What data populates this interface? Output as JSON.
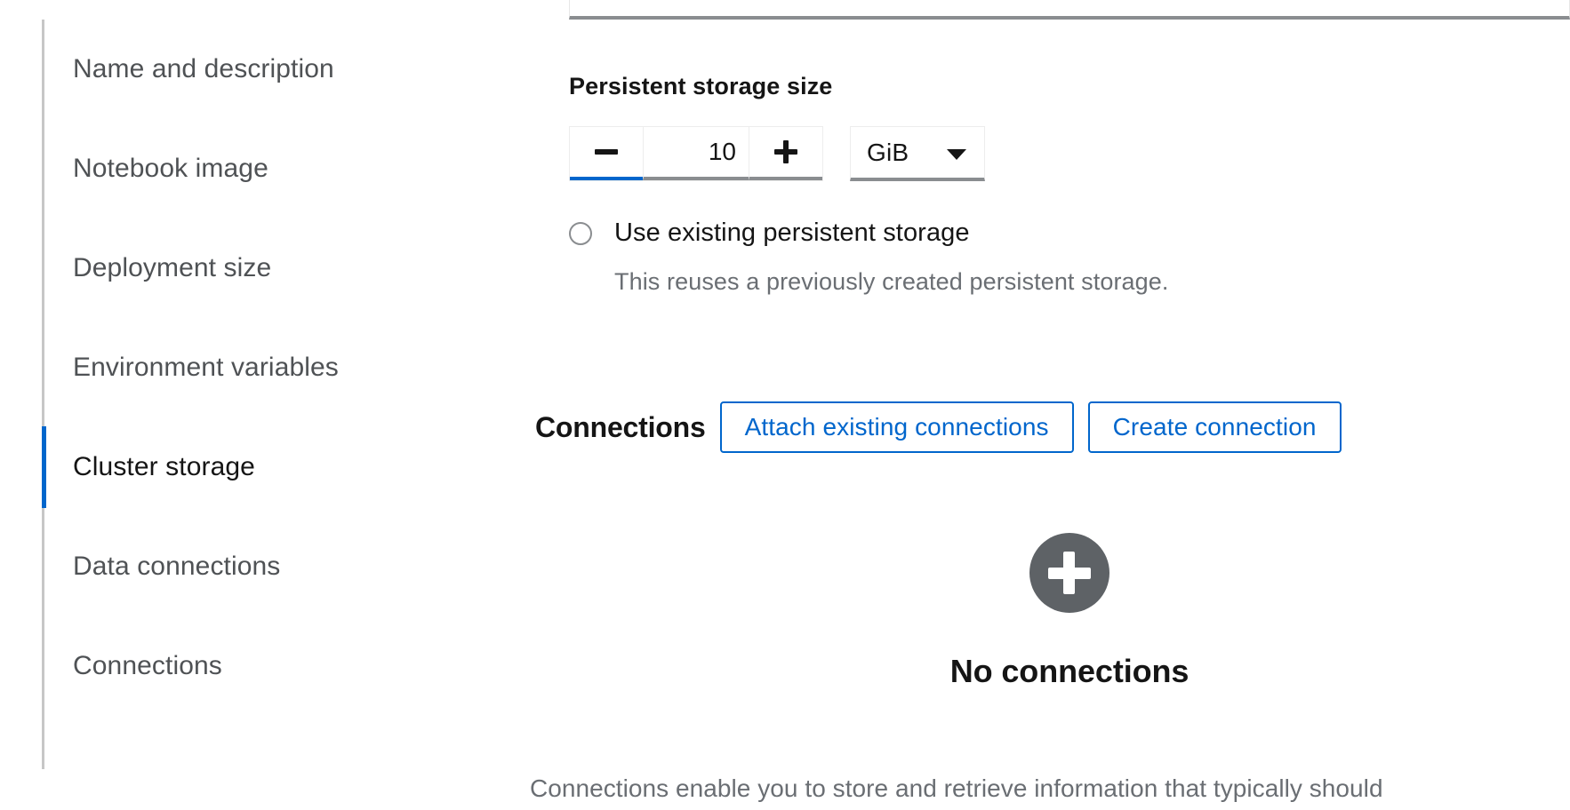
{
  "sidebar": {
    "items": [
      {
        "label": "Name and description",
        "active": false
      },
      {
        "label": "Notebook image",
        "active": false
      },
      {
        "label": "Deployment size",
        "active": false
      },
      {
        "label": "Environment variables",
        "active": false
      },
      {
        "label": "Cluster storage",
        "active": true
      },
      {
        "label": "Data connections",
        "active": false
      },
      {
        "label": "Connections",
        "active": false
      }
    ]
  },
  "storage": {
    "size_label": "Persistent storage size",
    "decrement_icon": "minus-icon",
    "increment_icon": "plus-icon",
    "size_value": "10",
    "unit_value": "GiB",
    "unit_caret_icon": "chevron-down-icon",
    "radio_label": "Use existing persistent storage",
    "radio_helper": "This reuses a previously created persistent storage.",
    "radio_checked": false
  },
  "connections": {
    "title": "Connections",
    "attach_button": "Attach existing connections",
    "create_button": "Create connection",
    "empty_icon": "plus-circle-icon",
    "empty_title": "No connections",
    "empty_body": "Connections enable you to store and retrieve information that typically should"
  },
  "colors": {
    "accent_blue": "#0066cc",
    "text_primary": "#151515",
    "text_muted": "#6a6e73",
    "border_gray": "#8a8d90",
    "empty_icon_gray": "#5e6266"
  }
}
